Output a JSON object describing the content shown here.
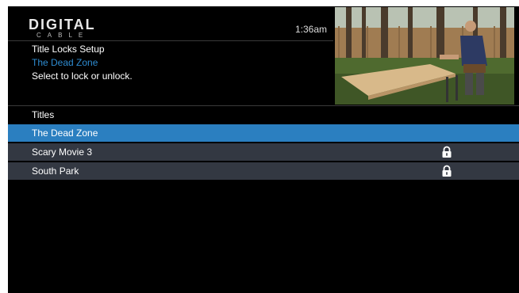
{
  "brand": {
    "line1": "DIGITAL",
    "line2": "CABLE"
  },
  "clock": "1:36am",
  "header": {
    "title": "Title Locks Setup",
    "current": "The Dead Zone",
    "instruction": "Select to lock or unlock."
  },
  "preview": {
    "icon": "live-tv-preview"
  },
  "titles_label": "Titles",
  "titles": [
    {
      "label": "The Dead Zone",
      "selected": true,
      "locked": false
    },
    {
      "label": "Scary Movie 3",
      "selected": false,
      "locked": true
    },
    {
      "label": "South Park",
      "selected": false,
      "locked": true
    }
  ],
  "colors": {
    "accent": "#2b7fc0",
    "accent_text": "#2e8bd0",
    "row_bg": "#333842",
    "background": "#000000"
  }
}
